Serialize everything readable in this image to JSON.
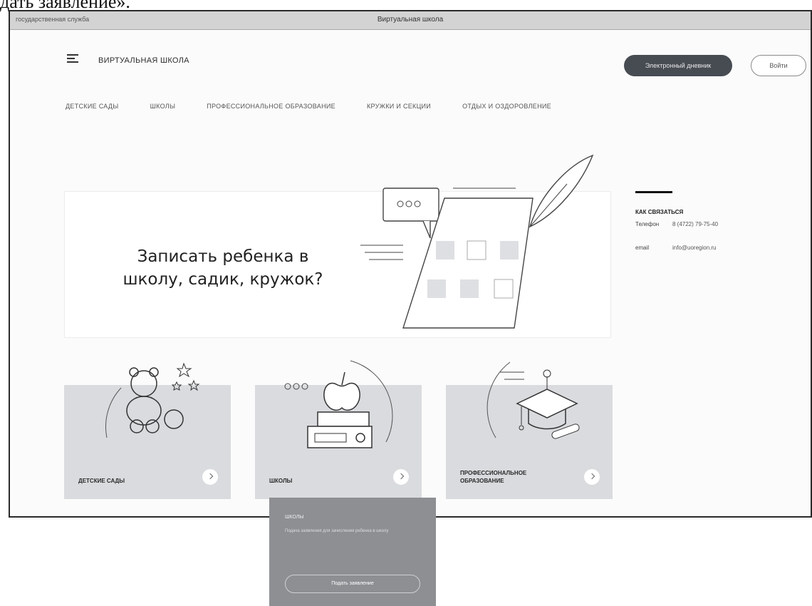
{
  "caption": "дать заявление».",
  "titlebar": {
    "left_text": "государственная служба",
    "title": "Виртуальная школа"
  },
  "header": {
    "logo": "ВИРТУАЛЬНАЯ ШКОЛА",
    "primary_button": "Электронный дневник",
    "login_button": "Войти"
  },
  "nav": [
    "ДЕТСКИЕ САДЫ",
    "ШКОЛЫ",
    "ПРОФЕССИОНАЛЬНОЕ ОБРАЗОВАНИЕ",
    "КРУЖКИ И СЕКЦИИ",
    "ОТДЫХ И ОЗДОРОВЛЕНИЕ"
  ],
  "hero": {
    "title": "Записать ребенка в школу, садик, кружок?"
  },
  "contacts": {
    "heading": "КАК СВЯЗАТЬСЯ",
    "phone_label": "Телефон",
    "phone_value": "8 (4722) 79-75-40",
    "email_label": "email",
    "email_value": "info@uoregion.ru"
  },
  "cards": [
    {
      "label": "ДЕТСКИЕ САДЫ"
    },
    {
      "label": "ШКОЛЫ"
    },
    {
      "label": "ПРОФЕССИОНАЛЬНОЕ ОБРАЗОВАНИЕ"
    }
  ],
  "popup": {
    "title": "ШКОЛЫ",
    "text": "Подача заявления для зачисления ребенка в школу",
    "button": "Подать заявление"
  },
  "colors": {
    "dark_button": "#474b52",
    "card_bg": "#d9dbde",
    "popup_bg": "#8d8f93"
  }
}
